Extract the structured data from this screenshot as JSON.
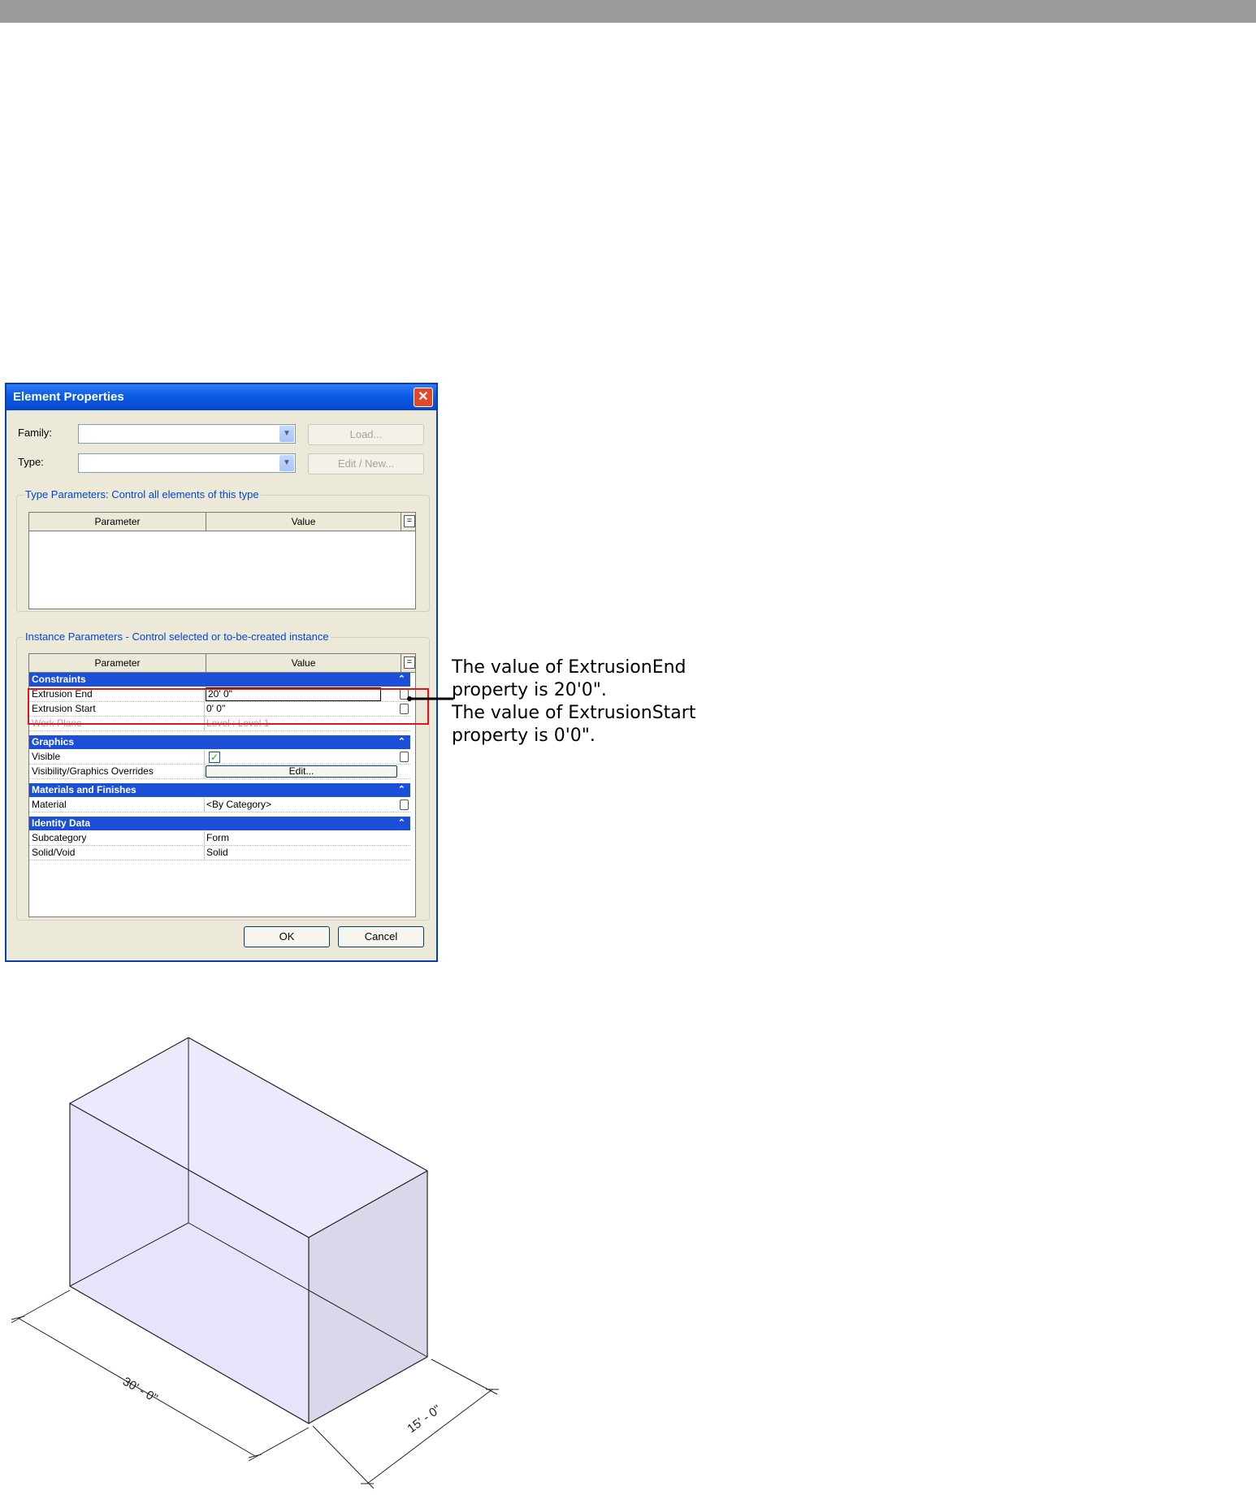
{
  "dialog": {
    "title": "Element Properties",
    "close_glyph": "✕",
    "family_label": "Family:",
    "type_label": "Type:",
    "family_value": "",
    "type_value": "",
    "load_button": "Load...",
    "edit_new_button": "Edit / New...",
    "type_params_title": "Type Parameters: Control all elements of this type",
    "instance_params_title": "Instance Parameters - Control selected or to-be-created instance",
    "col_parameter": "Parameter",
    "col_value": "Value",
    "eq_glyph": "=",
    "sections": {
      "constraints": "Constraints",
      "graphics": "Graphics",
      "materials": "Materials and Finishes",
      "identity": "Identity Data"
    },
    "rows": {
      "extrusion_end": {
        "name": "Extrusion End",
        "value": "20'  0\""
      },
      "extrusion_start": {
        "name": "Extrusion Start",
        "value": "0'  0\""
      },
      "work_plane": {
        "name": "Work Plane",
        "value": "Level : Level 1"
      },
      "visible": {
        "name": "Visible",
        "checked": true
      },
      "vis_overrides": {
        "name": "Visibility/Graphics Overrides",
        "button": "Edit..."
      },
      "material": {
        "name": "Material",
        "value": "<By Category>"
      },
      "subcategory": {
        "name": "Subcategory",
        "value": "Form"
      },
      "solid_void": {
        "name": "Solid/Void",
        "value": "Solid"
      }
    },
    "ok_button": "OK",
    "cancel_button": "Cancel",
    "chevron_glyph": "⌃",
    "dropdown_glyph": "▼",
    "check_glyph": "✓"
  },
  "annotation": {
    "line1": "The value of ExtrusionEnd",
    "line2": "property is 20'0\".",
    "line3": "The value of ExtrusionStart",
    "line4": "property is 0'0\"."
  },
  "drawing": {
    "dim_length": "30' - 0\"",
    "dim_width": "15' - 0\"",
    "fill_color": "#e8e2fb",
    "side_fill_color": "#dcd6ea"
  },
  "colors": {
    "title_blue": "#0b5ce6",
    "section_blue": "#1b4fd8",
    "highlight_red": "#e0161c",
    "dialog_bg": "#ece9d8"
  }
}
